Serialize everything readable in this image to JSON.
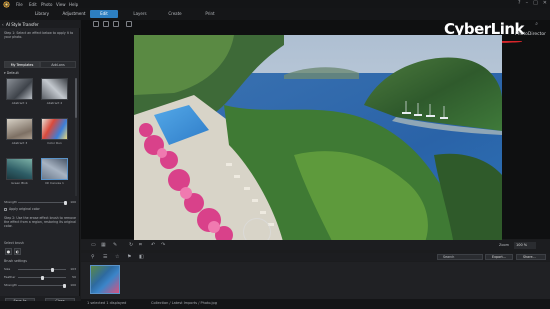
{
  "menu": {
    "items": [
      "File",
      "Edit",
      "Photo",
      "View",
      "Help"
    ]
  },
  "window_controls": [
    "?",
    "–",
    "□",
    "✕"
  ],
  "tabs": {
    "module_tabs": [
      "Library",
      "Adjustment"
    ],
    "main_tabs": [
      "Edit",
      "Layers",
      "Create",
      "Print"
    ],
    "active": "Edit"
  },
  "panel": {
    "title": "AI Style Transfer",
    "step1": "Step 1: Select an effect below to apply it to your photo.",
    "subtabs": [
      "My Templates",
      "Add-ons"
    ],
    "subtab_active": "My Templates",
    "default_header": "Default",
    "templates": [
      {
        "name": "Abstract 1",
        "colors": [
          "#7a7f86",
          "#3e434a"
        ]
      },
      {
        "name": "Abstract 2",
        "colors": [
          "#5d6168",
          "#9aa0a8"
        ]
      },
      {
        "name": "Abstract 3",
        "colors": [
          "#c9c3b8",
          "#7d7064"
        ]
      },
      {
        "name": "Color Run",
        "colors": [
          "#d94a3c",
          "#3c7fd9"
        ]
      },
      {
        "name": "Green Blob",
        "colors": [
          "#2e5d66",
          "#7bb0a6"
        ]
      },
      {
        "name": "Oil Canvas 1",
        "colors": [
          "#6c7a8c",
          "#a7b3c2"
        ]
      }
    ],
    "strength": {
      "label": "Strength",
      "value": "100"
    },
    "apply_original_color": "Apply original color",
    "step2": "Step 2: Use the erase effect brush to remove the effect from a region, restoring its original color.",
    "select_brush": "Select brush",
    "brush_settings": "Brush settings",
    "sliders": [
      {
        "label": "Size",
        "value": "103",
        "fraction": 0.72
      },
      {
        "label": "Feather",
        "value": "50",
        "fraction": 0.5
      },
      {
        "label": "Strength",
        "value": "100",
        "fraction": 0.98
      }
    ],
    "buttons": {
      "save_as": "Save As",
      "close": "Close"
    }
  },
  "view": {
    "brand": "CyberLink",
    "product": "PhotoDirector",
    "zoom_label": "Zoom",
    "zoom_value": "100 %"
  },
  "library_bar": {
    "search_placeholder": "Search",
    "export_label": "Export...",
    "share_label": "Share..."
  },
  "status": {
    "selection": "1 selected    1 displayed",
    "path": "Collection / Latest Imports / Photo.jpg"
  }
}
